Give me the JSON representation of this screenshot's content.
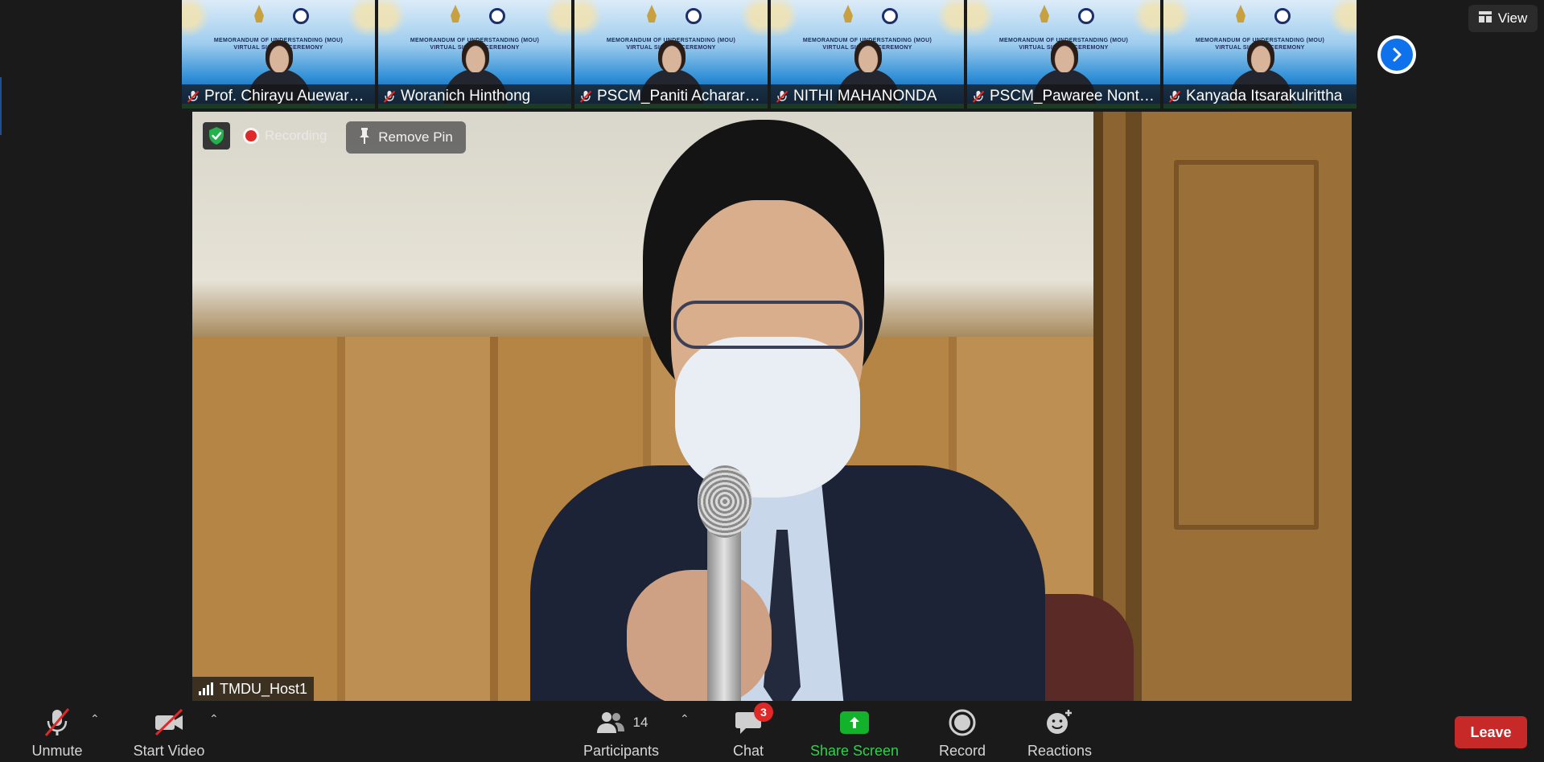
{
  "filmstrip": {
    "banner_line1": "MEMORANDUM OF UNDERSTANDING (MOU)",
    "banner_line2": "VIRTUAL SIGNING CEREMONY",
    "participants": [
      {
        "name": "Prof. Chirayu Auewara..."
      },
      {
        "name": "Woranich Hinthong"
      },
      {
        "name": "PSCM_Paniti Achararit,..."
      },
      {
        "name": "NITHI MAHANONDA"
      },
      {
        "name": "PSCM_Pawaree Nonthasa..."
      },
      {
        "name": "Kanyada Itsarakulrittha"
      }
    ]
  },
  "view_label": "View",
  "main_video": {
    "recording_label": "Recording",
    "remove_pin_label": "Remove Pin",
    "speaker_name": "TMDU_Host1"
  },
  "toolbar": {
    "unmute_label": "Unmute",
    "start_video_label": "Start Video",
    "participants_label": "Participants",
    "participants_count": "14",
    "chat_label": "Chat",
    "chat_badge": "3",
    "share_screen_label": "Share Screen",
    "record_label": "Record",
    "reactions_label": "Reactions",
    "leave_label": "Leave"
  },
  "colors": {
    "accent_blue": "#0e72ed",
    "share_green": "#12b22b",
    "leave_red": "#c72828",
    "badge_red": "#e02828"
  }
}
